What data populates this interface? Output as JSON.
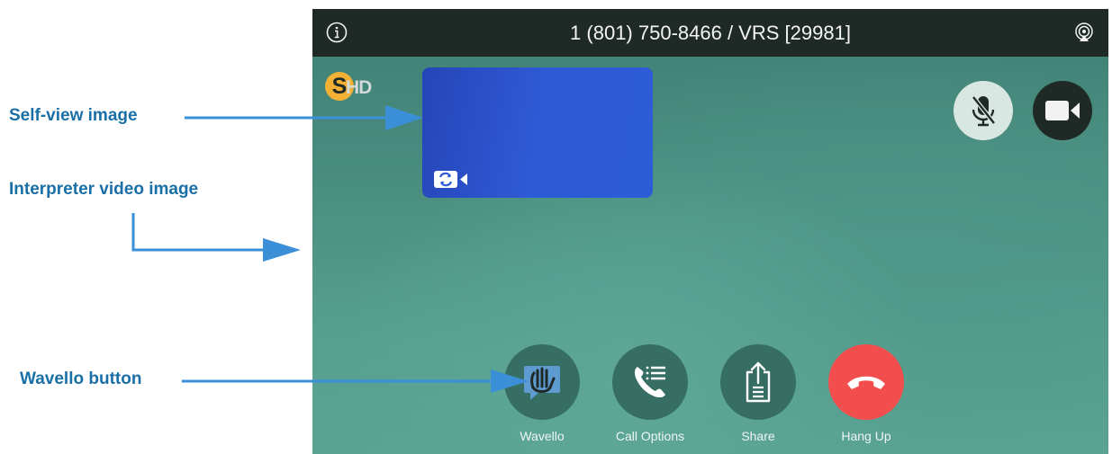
{
  "callouts": {
    "self_view": "Self-view image",
    "interpreter": "Interpreter video image",
    "wavello": "Wavello button"
  },
  "topbar": {
    "call_title": "1 (801) 750-8466 / VRS [29981]",
    "info_icon": "info-icon",
    "airplay_icon": "airplay-icon"
  },
  "logo": {
    "badge": "S",
    "suffix": "HD"
  },
  "controls": {
    "mute_icon": "microphone-muted-icon",
    "camera_icon": "video-camera-icon"
  },
  "actions": [
    {
      "label": "Wavello",
      "icon": "waving-hand-icon"
    },
    {
      "label": "Call Options",
      "icon": "phone-list-icon"
    },
    {
      "label": "Share",
      "icon": "share-document-icon"
    },
    {
      "label": "Hang Up",
      "icon": "hang-up-icon"
    }
  ],
  "colors": {
    "annotation": "#1a6fa7",
    "topbar": "#1f2a26",
    "selfview": "#2e5bd8",
    "hangup": "#f24e4e",
    "action_circle": "#366e64"
  }
}
